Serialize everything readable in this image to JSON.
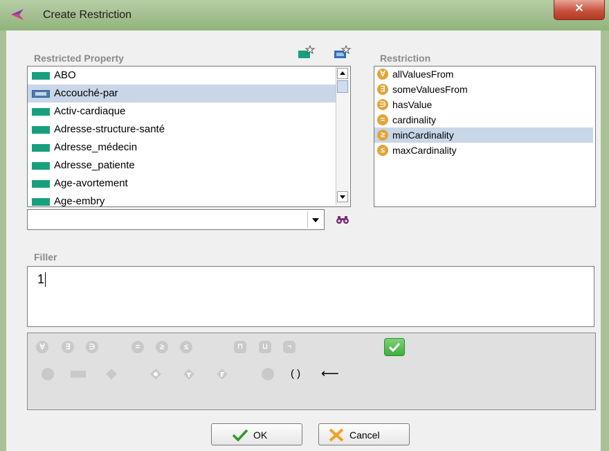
{
  "window": {
    "title": "Create Restriction",
    "close_glyph": "✕"
  },
  "properties": {
    "label": "Restricted Property",
    "add_icons": [
      "add-property-icon",
      "add-object-property-icon"
    ],
    "items": [
      {
        "label": "ABO",
        "selected": false
      },
      {
        "label": "Accouché-par",
        "selected": true
      },
      {
        "label": "Activ-cardiaque",
        "selected": false
      },
      {
        "label": "Adresse-structure-santé",
        "selected": false
      },
      {
        "label": "Adresse_médecin",
        "selected": false
      },
      {
        "label": "Adresse_patiente",
        "selected": false
      },
      {
        "label": "Age-avortement",
        "selected": false
      },
      {
        "label": "Age-embry",
        "selected": false
      }
    ],
    "search_value": "",
    "find_icon": "binoculars-icon"
  },
  "restriction": {
    "label": "Restriction",
    "items": [
      {
        "label": "allValuesFrom",
        "glyph": "∀",
        "selected": false
      },
      {
        "label": "someValuesFrom",
        "glyph": "∃",
        "selected": false
      },
      {
        "label": "hasValue",
        "glyph": "∋",
        "selected": false
      },
      {
        "label": "cardinality",
        "glyph": "=",
        "selected": false
      },
      {
        "label": "minCardinality",
        "glyph": "≥",
        "selected": true
      },
      {
        "label": "maxCardinality",
        "glyph": "≤",
        "selected": false
      }
    ]
  },
  "filler": {
    "label": "Filler",
    "value": "1"
  },
  "symbols": {
    "row1": [
      "∀",
      "∃",
      "∋",
      "=",
      "≥",
      "≤",
      "⊓",
      "⊔",
      "¬"
    ],
    "row2_text": {
      "parens": "( )",
      "arrow": "⟵"
    }
  },
  "buttons": {
    "ok": "OK",
    "cancel": "Cancel"
  },
  "colors": {
    "accent": "#18a07e",
    "selected_row": "#c8d6e8",
    "restriction_icon": "#e2a43a"
  }
}
